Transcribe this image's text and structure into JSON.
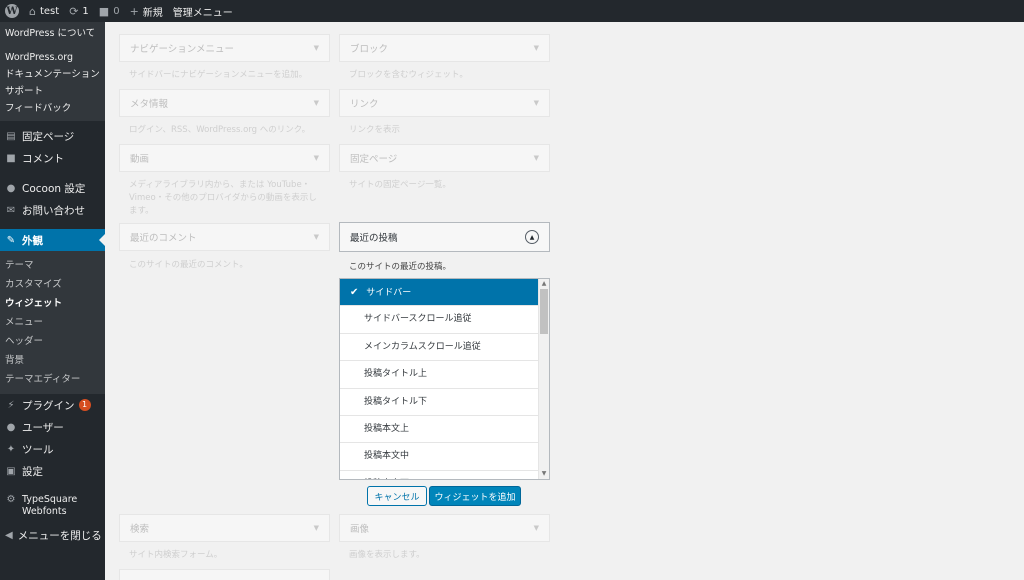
{
  "admin_bar": {
    "site_name": "test",
    "updates_count": "1",
    "comments_count": "0",
    "new_label": "新規",
    "management_menu": "管理メニュー"
  },
  "sidebar": {
    "wp_submenu": [
      "WordPress について",
      "WordPress.org",
      "ドキュメンテーション",
      "サポート",
      "フィードバック"
    ],
    "menu_top": [
      {
        "label": "固定ページ",
        "icon": "pages-icon"
      },
      {
        "label": "コメント",
        "icon": "comment-icon"
      },
      {
        "label": "Cocoon 設定",
        "icon": "cocoon-icon"
      },
      {
        "label": "お問い合わせ",
        "icon": "mail-icon"
      }
    ],
    "appearance": {
      "label": "外観",
      "icon": "brush-icon"
    },
    "appearance_sub": [
      "テーマ",
      "カスタマイズ",
      "ウィジェット",
      "メニュー",
      "ヘッダー",
      "背景",
      "テーマエディター"
    ],
    "menu_bottom": [
      {
        "label": "プラグイン",
        "icon": "plugin-icon",
        "badge": "1"
      },
      {
        "label": "ユーザー",
        "icon": "user-icon"
      },
      {
        "label": "ツール",
        "icon": "wrench-icon"
      },
      {
        "label": "設定",
        "icon": "settings-icon"
      }
    ],
    "typesquare": "TypeSquare Webfonts",
    "collapse": "メニューを閉じる"
  },
  "widgets": {
    "nav_menu": {
      "title": "ナビゲーションメニュー",
      "desc": "サイドバーにナビゲーションメニューを追加。"
    },
    "block": {
      "title": "ブロック",
      "desc": "ブロックを含むウィジェット。"
    },
    "meta": {
      "title": "メタ情報",
      "desc": "ログイン、RSS、WordPress.org へのリンク。"
    },
    "link": {
      "title": "リンク",
      "desc": "リンクを表示"
    },
    "video": {
      "title": "動画",
      "desc": "メディアライブラリ内から、または YouTube・Vimeo・その他のプロバイダからの動画を表示します。"
    },
    "pages": {
      "title": "固定ページ",
      "desc": "サイトの固定ページ一覧。"
    },
    "recent_comments": {
      "title": "最近のコメント",
      "desc": "このサイトの最近のコメント。"
    },
    "recent_posts": {
      "title": "最近の投稿",
      "desc": "このサイトの最近の投稿。"
    },
    "search": {
      "title": "検索",
      "desc": "サイト内検索フォーム。"
    },
    "image": {
      "title": "画像",
      "desc": "画像を表示します。"
    }
  },
  "chooser": {
    "options": [
      "サイドバー",
      "サイドバースクロール追従",
      "メインカラムスクロール追従",
      "投稿タイトル上",
      "投稿タイトル下",
      "投稿本文上",
      "投稿本文中",
      "投稿本文下"
    ],
    "selected": "サイドバー"
  },
  "buttons": {
    "cancel": "キャンセル",
    "add": "ウィジェットを追加"
  },
  "colors": {
    "accent": "#0073aa",
    "adminbar": "#23282d",
    "submenu": "#32373c",
    "badge": "#d54e21"
  }
}
